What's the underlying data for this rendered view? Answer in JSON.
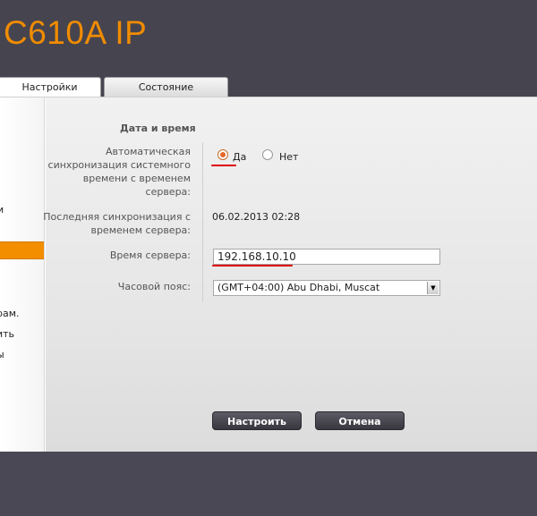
{
  "app": {
    "title": "C610A IP"
  },
  "tabs": [
    {
      "label": "Настройки",
      "active": true
    },
    {
      "label": "Состояние",
      "active": false
    }
  ],
  "sidebar": {
    "items": [
      {
        "label": "и"
      },
      {
        "label": "рам."
      },
      {
        "label": "ить"
      },
      {
        "label": "ы"
      }
    ]
  },
  "form": {
    "section_title": "Дата и время",
    "auto_sync": {
      "label": "Автоматическая синхронизация системного времени с временем сервера:",
      "options": [
        "Да",
        "Нет"
      ],
      "selected": "Да"
    },
    "last_sync": {
      "label": "Последняя синхронизация с временем сервера:",
      "value": "06.02.2013 02:28"
    },
    "server_time": {
      "label": "Время сервера:",
      "value": "192.168.10.10"
    },
    "timezone": {
      "label": "Часовой пояс:",
      "value": "(GMT+04:00) Abu Dhabi, Muscat"
    }
  },
  "buttons": {
    "apply": "Настроить",
    "cancel": "Отмена"
  },
  "colors": {
    "brand": "#f08c00",
    "background": "#46444f",
    "sidebar_active": "#f28e00",
    "annotation": "#e00000",
    "button": "#45444d"
  }
}
